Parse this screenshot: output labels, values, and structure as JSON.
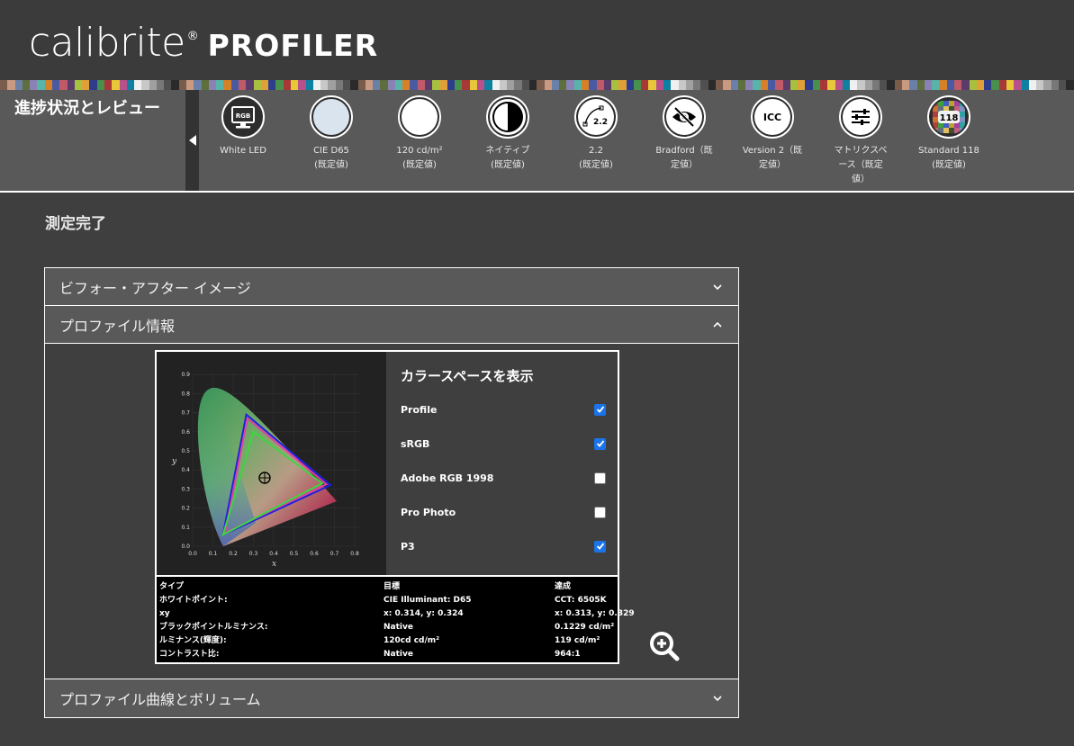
{
  "header": {
    "brand": "calibrite",
    "reg": "®",
    "product": "PROFILER",
    "swatch_colors": [
      "#7a5c4c",
      "#c89a82",
      "#6a80a8",
      "#5e6e3c",
      "#8a82b4",
      "#58b4a8",
      "#d68028",
      "#4a5aa2",
      "#c05a68",
      "#5a3c6a",
      "#a8c040",
      "#e0a038",
      "#2e3c8c",
      "#48904c",
      "#a83838",
      "#e8c838",
      "#b8508c",
      "#0e80a0",
      "#f0f0f0",
      "#c8c8c8",
      "#a0a0a0",
      "#787878",
      "#505050",
      "#2a2a2a"
    ]
  },
  "stepbar": {
    "title": "進捗状況とレビュー",
    "steps": [
      {
        "icon": "rgb-monitor-icon",
        "line1": "White LED",
        "line2": ""
      },
      {
        "icon": "cie-d65-circle-icon",
        "line1": "CIE D65",
        "line2": "(既定値)"
      },
      {
        "icon": "white-luminance-circle-icon",
        "line1": "120 cd/m²",
        "line2": "(既定値)"
      },
      {
        "icon": "half-contrast-circle-icon",
        "line1": "ネイティブ",
        "line2": "(既定値)"
      },
      {
        "icon": "gamma-curve-icon",
        "line1": "2.2",
        "line2": "(既定値)",
        "badge": "2.2"
      },
      {
        "icon": "eye-hidden-icon",
        "line1": "Bradford（既",
        "line2": "定値）"
      },
      {
        "icon": "icc-icon",
        "line1": "Version 2（既",
        "line2": "定値）",
        "badge": "ICC"
      },
      {
        "icon": "sliders-icon",
        "line1": "マトリクスベ",
        "line2": "ース（既定",
        "line3": "値）"
      },
      {
        "icon": "color-chart-icon",
        "line1": "Standard 118",
        "line2": "(既定値)",
        "badge": "118"
      }
    ]
  },
  "main": {
    "section_title": "測定完了",
    "accordion": [
      {
        "title": "ビフォー・アフター イメージ",
        "expanded": false
      },
      {
        "title": "プロファイル情報",
        "expanded": true
      },
      {
        "title": "プロファイル曲線とボリューム",
        "expanded": false
      }
    ]
  },
  "colorspace": {
    "title": "カラースペースを表示",
    "options": [
      {
        "label": "Profile",
        "checked": true
      },
      {
        "label": "sRGB",
        "checked": true
      },
      {
        "label": "Adobe RGB 1998",
        "checked": false
      },
      {
        "label": "Pro Photo",
        "checked": false
      },
      {
        "label": "P3",
        "checked": true
      }
    ]
  },
  "chart": {
    "x_label": "x",
    "y_label": "y",
    "x_ticks": [
      "0.0",
      "0.1",
      "0.2",
      "0.3",
      "0.4",
      "0.5",
      "0.6",
      "0.7",
      "0.8"
    ],
    "y_ticks": [
      "0.0",
      "0.1",
      "0.2",
      "0.3",
      "0.4",
      "0.5",
      "0.6",
      "0.7",
      "0.8",
      "0.9"
    ]
  },
  "info": {
    "headers": [
      "タイプ",
      "目標",
      "達成"
    ],
    "rows": [
      [
        "ホワイトポイント:",
        "CIE Illuminant: D65",
        "CCT: 6505K"
      ],
      [
        "xy",
        "x: 0.314, y: 0.324",
        "x: 0.313, y: 0.329"
      ],
      [
        "ブラックポイントルミナンス:",
        "Native",
        "0.1229 cd/m²"
      ],
      [
        "ルミナンス(輝度):",
        "120cd cd/m²",
        "119 cd/m²"
      ],
      [
        "コントラスト比:",
        "Native",
        "964:1"
      ]
    ]
  },
  "colors": {
    "profile": "#e040a0",
    "srgb": "#3cd640",
    "p3": "#2020e0",
    "accent": "#1a73e8"
  }
}
